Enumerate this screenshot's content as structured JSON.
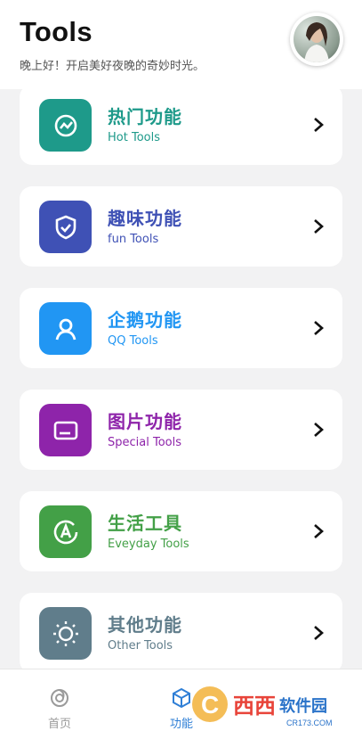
{
  "header": {
    "title": "Tools",
    "subtitle": "晚上好！开启美好夜晚的奇妙时光。"
  },
  "cards": [
    {
      "title": "热门功能",
      "subtitle": "Hot Tools",
      "color": "#1e9a8a",
      "icon": "hot-tools-icon"
    },
    {
      "title": "趣味功能",
      "subtitle": "fun Tools",
      "color": "#3f51b5",
      "icon": "shield-check-icon"
    },
    {
      "title": "企鹅功能",
      "subtitle": "QQ Tools",
      "color": "#2196f3",
      "icon": "user-icon"
    },
    {
      "title": "图片功能",
      "subtitle": "Special Tools",
      "color": "#8e24aa",
      "icon": "card-icon"
    },
    {
      "title": "生活工具",
      "subtitle": "Eveyday Tools",
      "color": "#43a047",
      "icon": "a-circle-icon"
    },
    {
      "title": "其他功能",
      "subtitle": "Other Tools",
      "color": "#607d8b",
      "icon": "sun-icon"
    }
  ],
  "tabbar": {
    "items": [
      {
        "label": "首页",
        "icon": "home-icon",
        "active": false
      },
      {
        "label": "功能",
        "icon": "cube-icon",
        "active": true
      }
    ],
    "active_color": "#2f7fd6",
    "inactive_color": "#9a9a9a"
  },
  "watermark": {
    "brand": "西西软件园",
    "site": "CR173.COM"
  }
}
